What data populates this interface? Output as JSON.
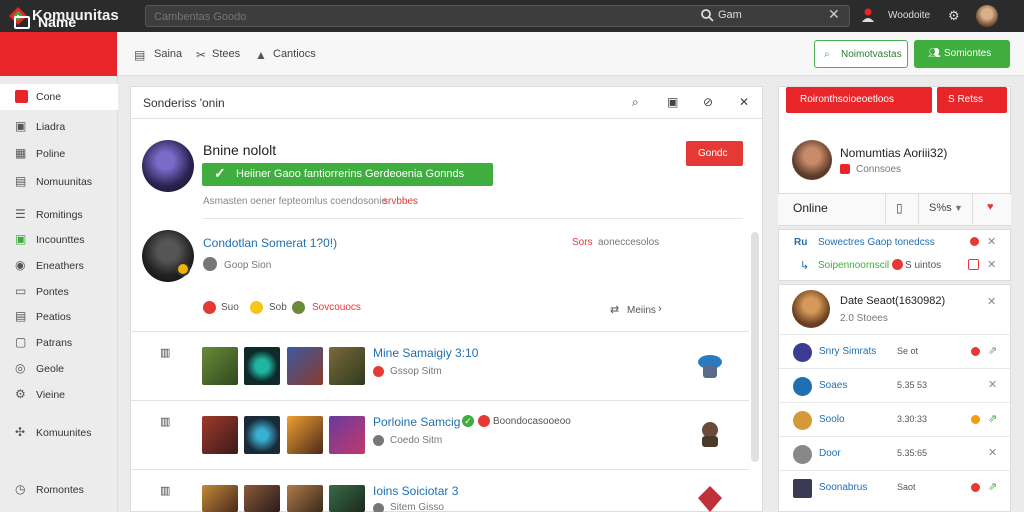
{
  "app": {
    "title": "Komuunitas"
  },
  "search": {
    "placeholder": "Cambentas Goodo",
    "button_label": "Gam",
    "clear_icon": "close-icon"
  },
  "topbar": {
    "user_name": "Woodoite"
  },
  "header": {
    "brand_label": "Name",
    "nav": [
      {
        "icon": "grid-icon",
        "label": "Saina"
      },
      {
        "icon": "tools-icon",
        "label": "Stees"
      },
      {
        "icon": "bag-icon",
        "label": "Cantiocs"
      }
    ],
    "btn_outline": "Noimotvastas",
    "btn_green": "Somiontes"
  },
  "sidebar": {
    "items": [
      {
        "icon": "inbox-icon",
        "label": "Cone",
        "active": true
      },
      {
        "icon": "folder-icon",
        "label": "Liadra"
      },
      {
        "icon": "image-icon",
        "label": "Poline"
      },
      {
        "icon": "grid-icon",
        "label": "Nomuunitas"
      },
      {
        "icon": "list-icon",
        "label": "Romitings"
      },
      {
        "icon": "badge-icon",
        "label": "Incounttes"
      },
      {
        "icon": "box-icon",
        "label": "Eneathers"
      },
      {
        "icon": "card-icon",
        "label": "Pontes"
      },
      {
        "icon": "doc-icon",
        "label": "Peatios"
      },
      {
        "icon": "file-icon",
        "label": "Patrans"
      },
      {
        "icon": "settings-icon",
        "label": "Geole"
      },
      {
        "icon": "gear-icon",
        "label": "Vieine"
      },
      {
        "icon": "people-icon",
        "label": "Komuunites"
      },
      {
        "icon": "clock-icon",
        "label": "Romontes"
      }
    ]
  },
  "main": {
    "title": "Sonderiss 'onin",
    "post": {
      "name": "Bnine nololt",
      "banner": "Heiiner Gaoo fantiorrerins Gerdeoenia Gonnds",
      "sub": "Asmasten oener fepteomlus coendosonie",
      "sub_red": "srvbbes",
      "action": "Gondc"
    },
    "comment": {
      "name": "Condotlan Somerat 1?0!)",
      "meta": "Goop Sion",
      "right_red": "Sors",
      "right": "aoneccesolos",
      "reactions": [
        "Suo",
        "Sob",
        "Sovcouocs"
      ],
      "more": "Meiins"
    },
    "rows": [
      {
        "title": "Mine Samaigiy 3:10",
        "meta": "Gssop Sitm",
        "badge_color": "#e53935"
      },
      {
        "title": "Porloine Samcig",
        "title_suffix": "Boondocasooeoo",
        "meta": "Coedo Sitm",
        "badge_color": "#777777"
      },
      {
        "title": "Ioins Soiciotar 3",
        "meta": "Sitem Gisso",
        "badge_color": "#777777"
      }
    ]
  },
  "right": {
    "btn1": "Roironthsoioeoetloos",
    "btn2": "S Retss",
    "profile_name": "Nomumtias Aoriii32)",
    "profile_sub": "Connsoes",
    "online": "Online",
    "online_num": "S%s",
    "lines": [
      {
        "prefix": "Ru",
        "text": "Sowectres Gaop tonedcss",
        "text_color": "#1f6fb2"
      },
      {
        "prefix": "",
        "text": "Soipennoornscil",
        "text_suffix": "S uintos",
        "text_color": "#3fae3f"
      }
    ],
    "big": {
      "name": "Date Seaot(1630982)",
      "sub": "2.0 Stoees"
    },
    "list": [
      {
        "name": "Snry Simrats",
        "num": "Se ot",
        "dot_color": "#e53935",
        "av": "#3b3b8f"
      },
      {
        "name": "Soaes",
        "num": "5.35 53",
        "dot_color": "",
        "av": "#1f6fb2"
      },
      {
        "name": "Soolo",
        "num": "3.30:33",
        "dot_color": "#f39c12",
        "av": "#d49a3a"
      },
      {
        "name": "Door",
        "num": "5.35:65",
        "dot_color": "",
        "av": "#888888"
      },
      {
        "name": "Soonabrus",
        "num": "Saot",
        "dot_color": "#e53935",
        "av": "#3a3a55"
      }
    ]
  },
  "colors": {
    "brand": "#e8262a",
    "green": "#3fae3f",
    "link": "#1f6fb2"
  }
}
